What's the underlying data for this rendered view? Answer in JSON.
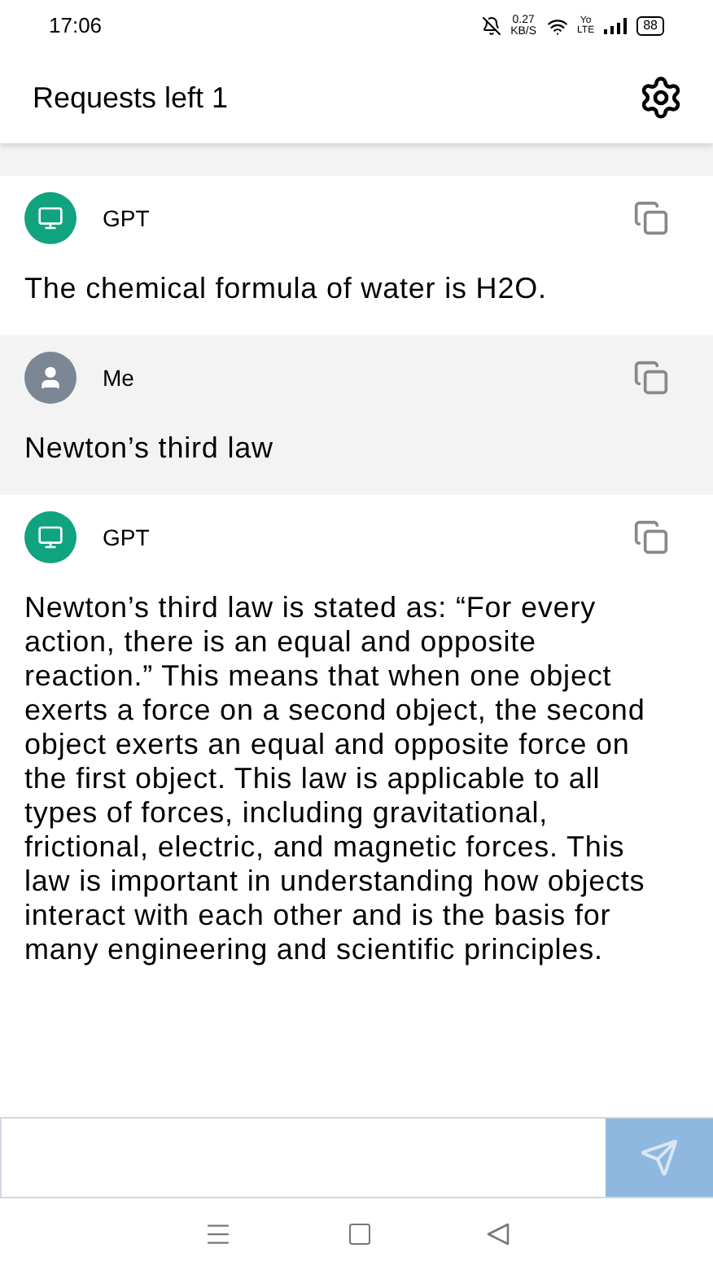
{
  "status_bar": {
    "time": "17:06",
    "speed_value": "0.27",
    "speed_unit": "KB/S",
    "volte_top": "Yo",
    "volte_bottom": "LTE",
    "battery": "88"
  },
  "header": {
    "title": "Requests left 1"
  },
  "messages": [
    {
      "kind": "bot",
      "author": "GPT",
      "text": "The chemical formula of water is H2O."
    },
    {
      "kind": "user",
      "author": "Me",
      "text": "Newton’s third law"
    },
    {
      "kind": "bot",
      "author": "GPT",
      "text": "Newton’s third law is stated as: “For every action, there is an equal and opposite reaction.” This means that when one object exerts a force on a second object, the second object exerts an equal and opposite force on the first object. This law is applicable to all types of forces, including gravitational, frictional, electric, and magnetic forces. This law is important in understanding how objects interact with each other and is the basis for many engineering and scientific principles."
    }
  ]
}
